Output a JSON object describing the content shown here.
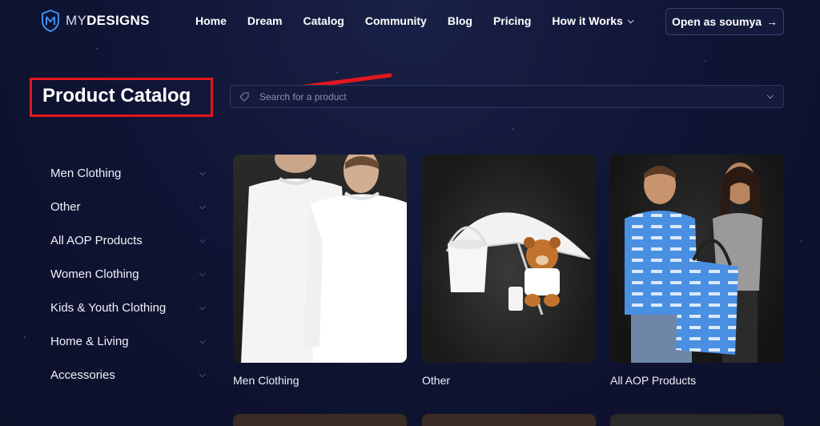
{
  "brand": {
    "prefix": "MY",
    "name": "DESIGNS"
  },
  "nav": {
    "items": [
      {
        "label": "Home"
      },
      {
        "label": "Dream"
      },
      {
        "label": "Catalog"
      },
      {
        "label": "Community"
      },
      {
        "label": "Blog"
      },
      {
        "label": "Pricing"
      },
      {
        "label": "How it Works"
      }
    ],
    "open_button": "Open as soumya",
    "open_button_icon": "arrow-right-icon"
  },
  "page": {
    "title": "Product Catalog"
  },
  "search": {
    "placeholder": "Search for a product"
  },
  "sidebar": {
    "items": [
      {
        "label": "Men Clothing"
      },
      {
        "label": "Other"
      },
      {
        "label": "All AOP Products"
      },
      {
        "label": "Women Clothing"
      },
      {
        "label": "Kids & Youth Clothing"
      },
      {
        "label": "Home & Living"
      },
      {
        "label": "Accessories"
      }
    ]
  },
  "catalog": {
    "cards": [
      {
        "label": "Men Clothing"
      },
      {
        "label": "Other"
      },
      {
        "label": "All AOP Products"
      }
    ]
  },
  "colors": {
    "background": "#0f1433",
    "highlight": "#e3171c",
    "accent": "#4a90e2"
  }
}
